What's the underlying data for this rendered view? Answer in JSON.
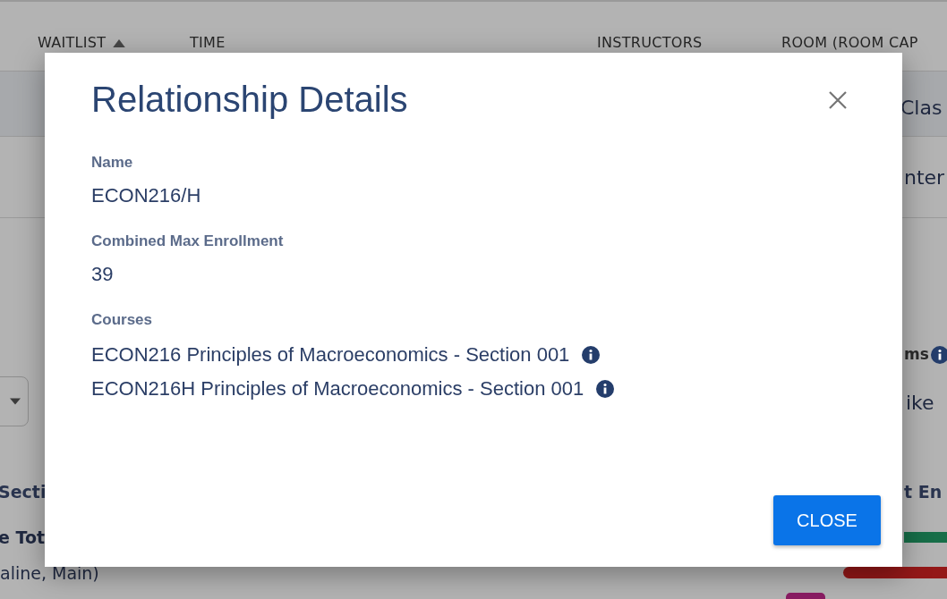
{
  "background": {
    "table_headers": [
      {
        "label": "WAITLIST",
        "sorted": true
      },
      {
        "label": "TIME",
        "sorted": false
      },
      {
        "label": "INSTRUCTORS",
        "sorted": false
      },
      {
        "label": "ROOM (ROOM CAP",
        "sorted": false
      }
    ],
    "fragments": [
      {
        "kind": "room1",
        "text": "Clas"
      },
      {
        "kind": "room2",
        "text": "nter"
      },
      {
        "kind": "filter-label",
        "text": "ms"
      },
      {
        "kind": "filter-value",
        "text": "ike"
      },
      {
        "kind": "section-header",
        "text": "Secti"
      },
      {
        "kind": "enroll-header",
        "text": "t En"
      },
      {
        "kind": "total",
        "text": "e Tot"
      },
      {
        "kind": "location",
        "text": "aline, Main)"
      }
    ],
    "bars": [
      {
        "kind": "green",
        "color": "#176e48"
      },
      {
        "kind": "red",
        "color": "#941818"
      },
      {
        "kind": "tag",
        "color": "#8a1c63"
      }
    ]
  },
  "dialog": {
    "title": "Relationship Details",
    "fields": [
      {
        "label": "Name",
        "value": "ECON216/H"
      },
      {
        "label": "Combined Max Enrollment",
        "value": "39"
      }
    ],
    "courses_label": "Courses",
    "courses": [
      "ECON216 Principles of Macroeconomics - Section 001",
      "ECON216H Principles of Macroeconomics - Section 001"
    ],
    "close_button": "CLOSE"
  }
}
